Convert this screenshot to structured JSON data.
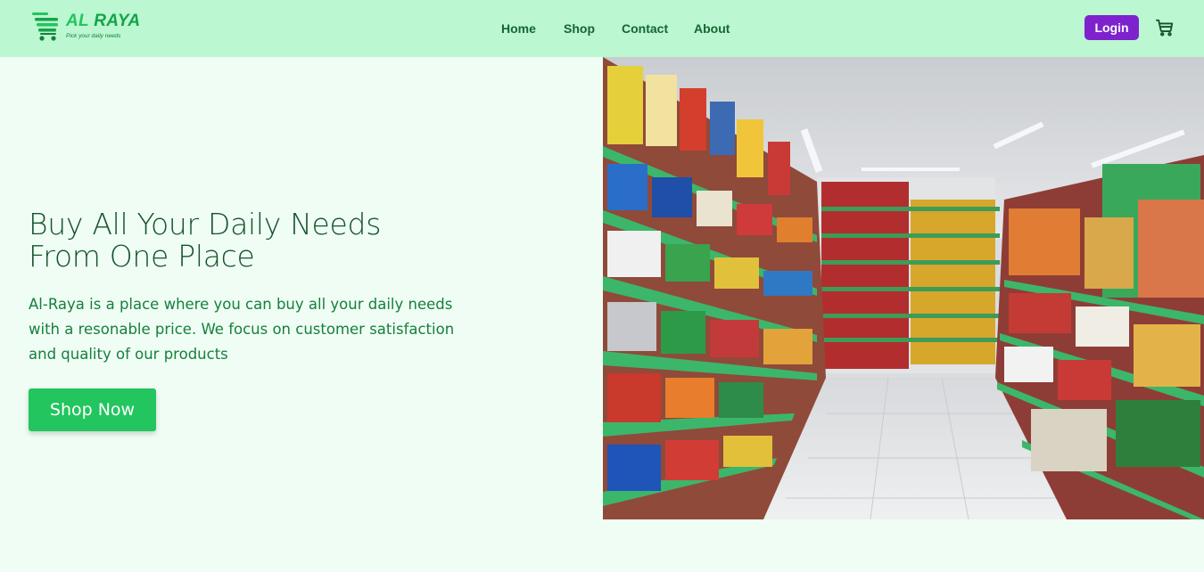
{
  "brand": {
    "name_first": "AL",
    "name_second": "RAYA",
    "tagline": "Pick your daily needs",
    "color_primary": "#22c55e",
    "color_dark": "#15803d"
  },
  "nav": {
    "items": [
      {
        "label": "Home"
      },
      {
        "label": "Shop"
      },
      {
        "label": "Contact"
      },
      {
        "label": "About"
      }
    ],
    "login_label": "Login",
    "cart_icon": "shopping-cart-icon"
  },
  "hero": {
    "title": "Buy All Your Daily Needs From One Place",
    "description": "Al-Raya is a place where you can buy all your daily needs with a resonable price. We focus on customer satisfaction and quality of our products",
    "cta_label": "Shop Now",
    "image_subject": "supermarket aisle with stocked green shelves"
  },
  "colors": {
    "navbar_bg": "#bbf7d0",
    "page_bg": "#f0fdf4",
    "login_bg": "#7e22ce",
    "cta_bg": "#22c55e",
    "title_color": "#14532d",
    "text_color": "#15803d"
  }
}
